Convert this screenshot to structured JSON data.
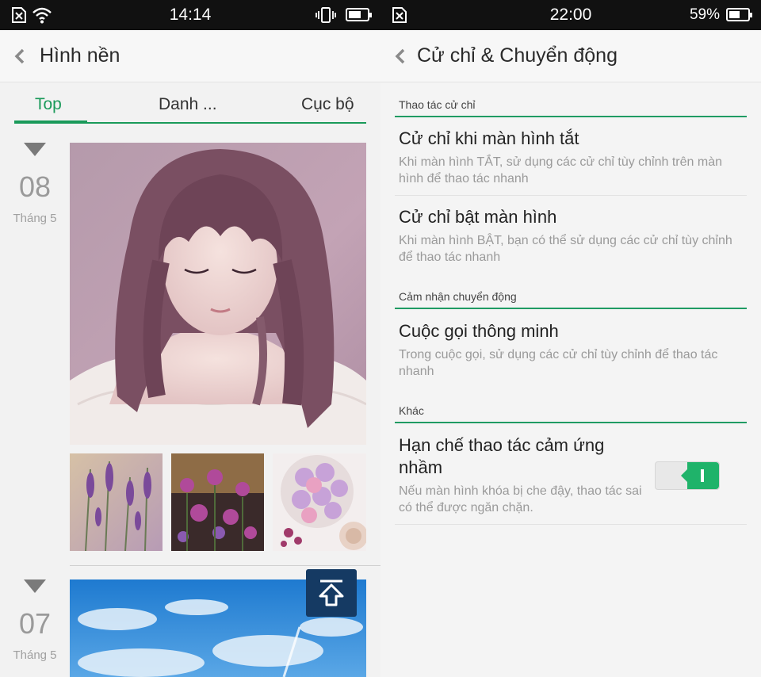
{
  "left": {
    "status": {
      "time": "14:14",
      "icons": [
        "no-sim-icon",
        "wifi-icon",
        "vibrate-icon",
        "battery-icon"
      ],
      "battery_level": 0.7
    },
    "appbar": {
      "back_icon": "chevron-left-icon",
      "title": "Hình nền"
    },
    "tabs": [
      {
        "label": "Top",
        "active": true
      },
      {
        "label": "Danh ..."
      },
      {
        "label": "Cục bộ"
      }
    ],
    "days": [
      {
        "day": "08",
        "month": "Tháng 5"
      },
      {
        "day": "07",
        "month": "Tháng 5"
      }
    ],
    "scroll_top_icon": "arrow-up-to-top-icon",
    "colors": {
      "accent": "#1a9a5a",
      "scroll_top_bg": "#153a63"
    }
  },
  "right": {
    "status": {
      "time": "22:00",
      "battery_percent": "59%",
      "battery_level": 0.59,
      "icons": [
        "no-sim-icon",
        "battery-icon"
      ]
    },
    "appbar": {
      "back_icon": "chevron-left-icon",
      "title": "Cử chỉ & Chuyển động"
    },
    "sections": [
      {
        "header": "Thao tác cử chỉ",
        "items": [
          {
            "title": "Cử chỉ khi màn hình tắt",
            "desc": "Khi màn hình TẮT, sử dụng các cử chỉ tùy chỉnh trên màn hình để thao tác nhanh"
          },
          {
            "title": "Cử chỉ bật màn hình",
            "desc": "Khi màn hình BẬT, bạn có thể sử dụng các cử chỉ tùy chỉnh để thao tác nhanh"
          }
        ]
      },
      {
        "header": "Cảm nhận chuyển động",
        "items": [
          {
            "title": "Cuộc gọi thông minh",
            "desc": "Trong cuộc gọi, sử dụng các cử chỉ tùy chỉnh để thao tác nhanh"
          }
        ]
      },
      {
        "header": "Khác",
        "items": [
          {
            "title": "Hạn chế thao tác cảm ứng nhầm",
            "desc": "Nếu màn hình khóa bị che đậy, thao tác sai có thể được ngăn chặn.",
            "toggle_on": true
          }
        ]
      }
    ],
    "colors": {
      "accent": "#1f9b63",
      "toggle_on": "#1fb36a"
    }
  }
}
